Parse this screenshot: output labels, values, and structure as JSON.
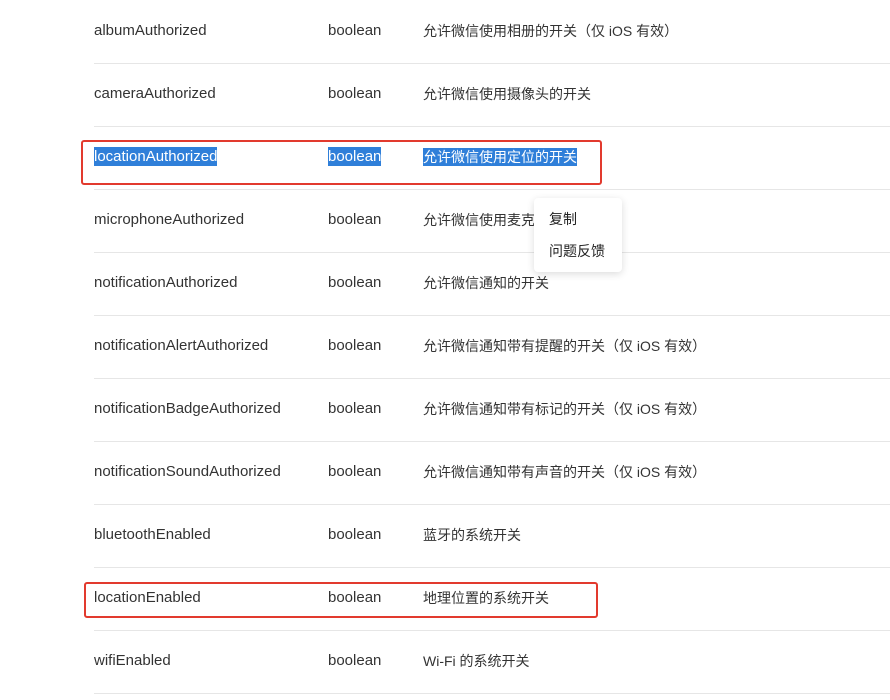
{
  "rows": [
    {
      "name": "albumAuthorized",
      "type": "boolean",
      "desc": "允许微信使用相册的开关（仅 iOS 有效）"
    },
    {
      "name": "cameraAuthorized",
      "type": "boolean",
      "desc": "允许微信使用摄像头的开关"
    },
    {
      "name": "locationAuthorized",
      "type": "boolean",
      "desc": "允许微信使用定位的开关"
    },
    {
      "name": "microphoneAuthorized",
      "type": "boolean",
      "desc": "允许微信使用麦克"
    },
    {
      "name": "notificationAuthorized",
      "type": "boolean",
      "desc": "允许微信通知的开关"
    },
    {
      "name": "notificationAlertAuthorized",
      "type": "boolean",
      "desc": "允许微信通知带有提醒的开关（仅 iOS 有效）"
    },
    {
      "name": "notificationBadgeAuthorized",
      "type": "boolean",
      "desc": "允许微信通知带有标记的开关（仅 iOS 有效）"
    },
    {
      "name": "notificationSoundAuthorized",
      "type": "boolean",
      "desc": "允许微信通知带有声音的开关（仅 iOS 有效）"
    },
    {
      "name": "bluetoothEnabled",
      "type": "boolean",
      "desc": "蓝牙的系统开关"
    },
    {
      "name": "locationEnabled",
      "type": "boolean",
      "desc": "地理位置的系统开关"
    },
    {
      "name": "wifiEnabled",
      "type": "boolean",
      "desc": "Wi-Fi 的系统开关"
    }
  ],
  "context_menu": {
    "items": [
      "复制",
      "问题反馈"
    ]
  },
  "colors": {
    "selection": "#2f7fd9",
    "annotation_box": "#e23a2e",
    "divider": "#e6e6e6"
  }
}
